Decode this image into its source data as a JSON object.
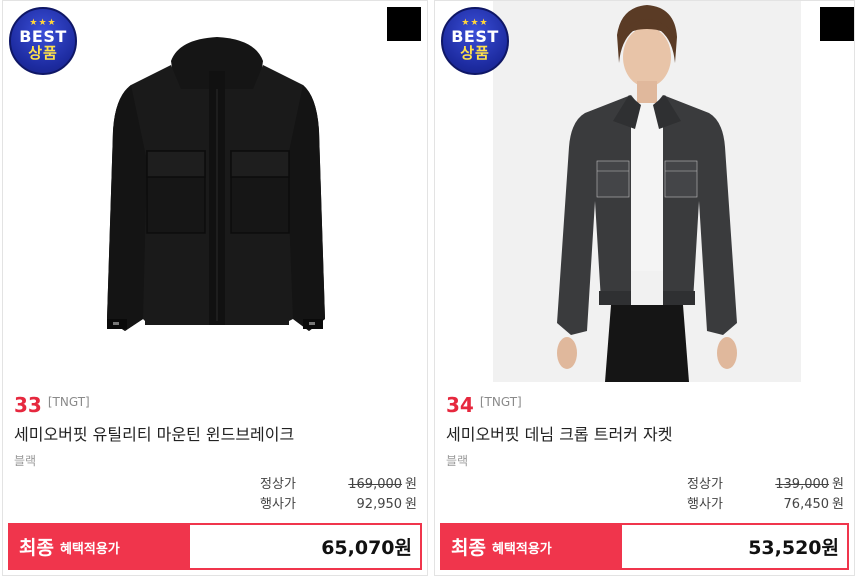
{
  "products": [
    {
      "badge": {
        "stars": "★★★",
        "line1": "BEST",
        "line2": "상품"
      },
      "rank": "33",
      "brand": "[TNGT]",
      "name": "세미오버핏 유틸리티 마운틴 윈드브레이크",
      "color": "블랙",
      "regular_label": "정상가",
      "regular_price": "169,000",
      "sale_label": "행사가",
      "sale_price": "92,950",
      "currency": "원",
      "final_label_big": "최종",
      "final_label_small": "혜택적용가",
      "final_price": "65,070원",
      "image_icon": "black-hooded-jacket"
    },
    {
      "badge": {
        "stars": "★★★",
        "line1": "BEST",
        "line2": "상품"
      },
      "rank": "34",
      "brand": "[TNGT]",
      "name": "세미오버핏 데님 크롭 트러커 자켓",
      "color": "블랙",
      "regular_label": "정상가",
      "regular_price": "139,000",
      "sale_label": "행사가",
      "sale_price": "76,450",
      "currency": "원",
      "final_label_big": "최종",
      "final_label_small": "혜택적용가",
      "final_price": "53,520원",
      "image_icon": "model-denim-jacket"
    }
  ],
  "colors": {
    "accent": "#f0354c",
    "rank": "#e6283e",
    "badge_blue": "#1c2a9e",
    "badge_gold": "#ffd43b"
  }
}
